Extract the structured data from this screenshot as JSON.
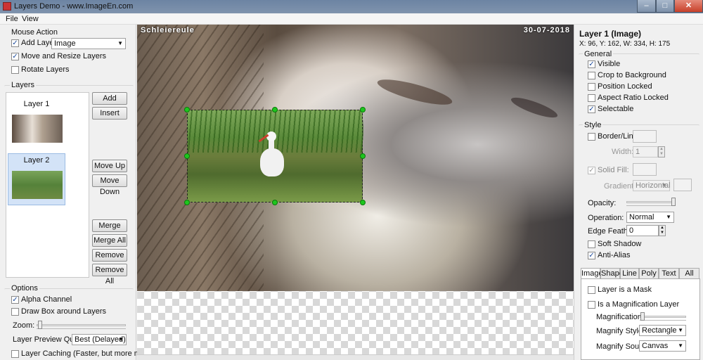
{
  "window": {
    "title": "Layers Demo - www.ImageEn.com",
    "minimize": "–",
    "maximize": "□",
    "close": "✕"
  },
  "menu": [
    "File",
    "View"
  ],
  "left": {
    "mouse_action": {
      "title": "Mouse Action",
      "add_layer_label": "Add Layer:",
      "add_layer_checked": true,
      "add_layer_type": "Image",
      "move_resize_label": "Move and Resize Layers",
      "move_resize_checked": true,
      "rotate_label": "Rotate Layers",
      "rotate_checked": false
    },
    "layers": {
      "title": "Layers",
      "items": [
        "Layer 1",
        "Layer 2"
      ],
      "selected": "Layer 2",
      "buttons": {
        "add": "Add",
        "insert": "Insert",
        "move_up": "Move Up",
        "move_down": "Move Down",
        "merge": "Merge",
        "merge_all": "Merge All",
        "remove": "Remove",
        "remove_all": "Remove All"
      }
    },
    "options": {
      "title": "Options",
      "alpha_label": "Alpha Channel",
      "alpha_checked": true,
      "draw_box_label": "Draw Box around Layers",
      "draw_box_checked": false,
      "zoom_label": "Zoom:",
      "preview_quality_label": "Layer Preview Quality:",
      "preview_quality_value": "Best (Delayed)",
      "caching_label": "Layer Caching (Faster, but more memory)",
      "caching_checked": false
    }
  },
  "canvas": {
    "caption_left": "Schleiereule",
    "caption_right": "30-07-2018"
  },
  "right": {
    "heading": "Layer 1 (Image)",
    "coords": "X: 96, Y: 162, W: 334, H: 175",
    "general": {
      "title": "General",
      "visible": "Visible",
      "crop": "Crop to Background",
      "position_locked": "Position Locked",
      "aspect_locked": "Aspect Ratio Locked",
      "selectable": "Selectable"
    },
    "style": {
      "title": "Style",
      "border_line": "Border/Line:",
      "width_label": "Width:",
      "width_value": "1",
      "solid_fill": "Solid Fill:",
      "gradient_label": "Gradient:",
      "gradient_value": "Horizontal",
      "opacity_label": "Opacity:",
      "operation_label": "Operation:",
      "operation_value": "Normal",
      "edge_feather_label": "Edge Feather:",
      "edge_feather_value": "0",
      "soft_shadow": "Soft Shadow",
      "anti_alias": "Anti-Alias"
    },
    "tabs": [
      "Image",
      "Shape",
      "Line",
      "Poly",
      "Text",
      "All"
    ],
    "image_tab": {
      "mask": "Layer is a Mask",
      "magnification_layer": "Is a Magnification Layer",
      "magnification_label": "Magnification:",
      "magnify_style_label": "Magnify Style:",
      "magnify_style_value": "Rectangle",
      "magnify_source_label": "Magnify Source:",
      "magnify_source_value": "Canvas"
    }
  },
  "checkmark": "✓"
}
